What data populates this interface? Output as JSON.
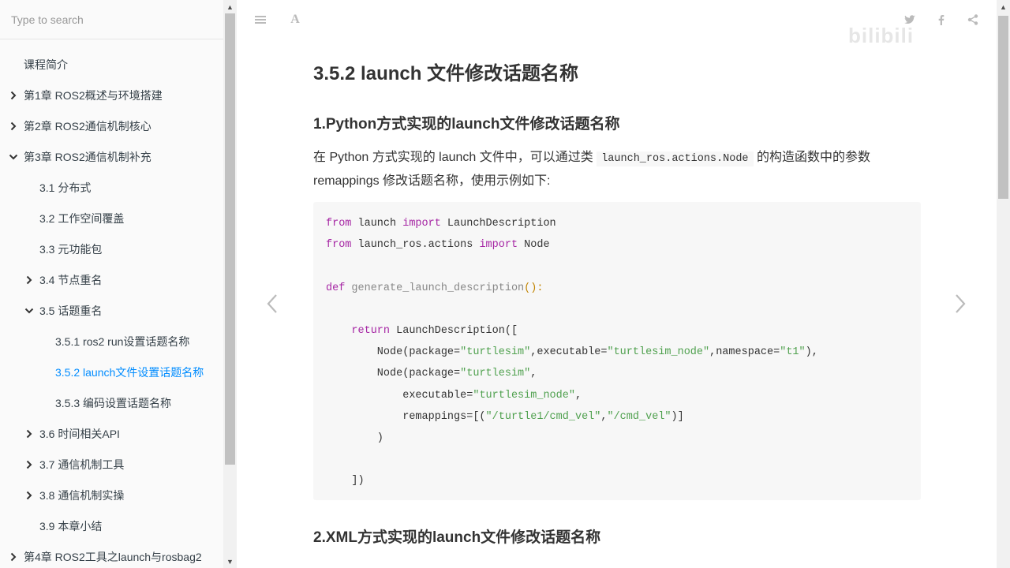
{
  "search": {
    "placeholder": "Type to search"
  },
  "sidebar": {
    "items": [
      {
        "label": "课程简介",
        "level": 0,
        "chevron": "none"
      },
      {
        "label": "第1章 ROS2概述与环境搭建",
        "level": 0,
        "chevron": "right"
      },
      {
        "label": "第2章 ROS2通信机制核心",
        "level": 0,
        "chevron": "right"
      },
      {
        "label": "第3章 ROS2通信机制补充",
        "level": 0,
        "chevron": "down"
      },
      {
        "label": "3.1 分布式",
        "level": 1,
        "chevron": "none"
      },
      {
        "label": "3.2 工作空间覆盖",
        "level": 1,
        "chevron": "none"
      },
      {
        "label": "3.3 元功能包",
        "level": 1,
        "chevron": "none"
      },
      {
        "label": "3.4 节点重名",
        "level": 1,
        "chevron": "right"
      },
      {
        "label": "3.5 话题重名",
        "level": 1,
        "chevron": "down"
      },
      {
        "label": "3.5.1 ros2 run设置话题名称",
        "level": 2,
        "chevron": "none"
      },
      {
        "label": "3.5.2 launch文件设置话题名称",
        "level": 2,
        "chevron": "none",
        "active": true
      },
      {
        "label": "3.5.3 编码设置话题名称",
        "level": 2,
        "chevron": "none"
      },
      {
        "label": "3.6 时间相关API",
        "level": 1,
        "chevron": "right"
      },
      {
        "label": "3.7 通信机制工具",
        "level": 1,
        "chevron": "right"
      },
      {
        "label": "3.8 通信机制实操",
        "level": 1,
        "chevron": "right"
      },
      {
        "label": "3.9 本章小结",
        "level": 1,
        "chevron": "none"
      },
      {
        "label": "第4章 ROS2工具之launch与rosbag2",
        "level": 0,
        "chevron": "right"
      }
    ]
  },
  "header": {
    "icons": [
      "menu-icon",
      "font-settings-icon",
      "twitter-icon",
      "facebook-icon",
      "share-icon"
    ],
    "font_button": "A",
    "watermark": "bilibili"
  },
  "content": {
    "title": "3.5.2 launch 文件修改话题名称",
    "section1_title": "1.Python方式实现的launch文件修改话题名称",
    "para_prefix": "在 Python 方式实现的 launch 文件中，可以通过类",
    "para_code": "launch_ros.actions.Node",
    "para_suffix": "的构造函数中的参数 remappings 修改话题名称，使用示例如下:",
    "code_lines": [
      [
        {
          "t": "from",
          "c": "kw"
        },
        {
          "t": " launch "
        },
        {
          "t": "import",
          "c": "kw"
        },
        {
          "t": " LaunchDescription"
        }
      ],
      [
        {
          "t": "from",
          "c": "kw"
        },
        {
          "t": " launch_ros.actions "
        },
        {
          "t": "import",
          "c": "kw"
        },
        {
          "t": " Node"
        }
      ],
      [],
      [
        {
          "t": "def",
          "c": "kw"
        },
        {
          "t": " "
        },
        {
          "t": "generate_launch_description",
          "c": "fn"
        },
        {
          "t": "():",
          "c": "paren"
        }
      ],
      [],
      [
        {
          "t": "    "
        },
        {
          "t": "return",
          "c": "kw"
        },
        {
          "t": " LaunchDescription(["
        }
      ],
      [
        {
          "t": "        Node(package="
        },
        {
          "t": "\"turtlesim\"",
          "c": "str"
        },
        {
          "t": ",executable="
        },
        {
          "t": "\"turtlesim_node\"",
          "c": "str"
        },
        {
          "t": ",namespace="
        },
        {
          "t": "\"t1\"",
          "c": "str"
        },
        {
          "t": "),"
        }
      ],
      [
        {
          "t": "        Node(package="
        },
        {
          "t": "\"turtlesim\"",
          "c": "str"
        },
        {
          "t": ","
        }
      ],
      [
        {
          "t": "            executable="
        },
        {
          "t": "\"turtlesim_node\"",
          "c": "str"
        },
        {
          "t": ","
        }
      ],
      [
        {
          "t": "            remappings=[("
        },
        {
          "t": "\"/turtle1/cmd_vel\"",
          "c": "str"
        },
        {
          "t": ","
        },
        {
          "t": "\"/cmd_vel\"",
          "c": "str"
        },
        {
          "t": ")]"
        }
      ],
      [
        {
          "t": "        )"
        }
      ],
      [],
      [
        {
          "t": "    ])"
        }
      ]
    ],
    "section2_title": "2.XML方式实现的launch文件修改话题名称"
  },
  "colors": {
    "active_link": "#008cff",
    "keyword": "#a626a4",
    "string": "#50a14f",
    "code_bg": "#f7f7f7"
  }
}
